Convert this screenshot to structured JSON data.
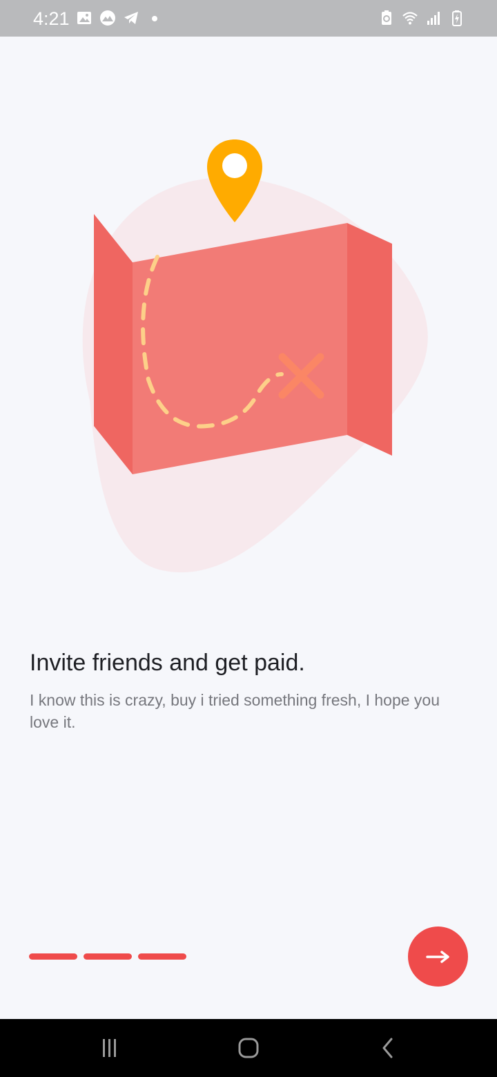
{
  "status_bar": {
    "time": "4:21",
    "left_icons": [
      "gallery-icon",
      "app-icon",
      "telegram-icon",
      "notification-dot-icon"
    ],
    "right_icons": [
      "battery-saver-icon",
      "wifi-icon",
      "signal-icon",
      "battery-charging-icon"
    ]
  },
  "onboarding": {
    "title": "Invite friends and get paid.",
    "description": "I know this is crazy, buy i tried something fresh, I hope you love it.",
    "page_count": 3
  },
  "next_button": {
    "icon": "arrow-right-icon"
  },
  "nav_bar": {
    "buttons": [
      "recent-apps-icon",
      "home-icon",
      "back-icon"
    ]
  },
  "colors": {
    "accent": "#ef4b4b",
    "background": "#f6f7fb",
    "map_main": "#f27b76",
    "map_side": "#ef6661",
    "blob": "#f7e9ed",
    "pin": "#ffab00",
    "trail": "#fdd089",
    "x_mark": "#fb8665"
  }
}
